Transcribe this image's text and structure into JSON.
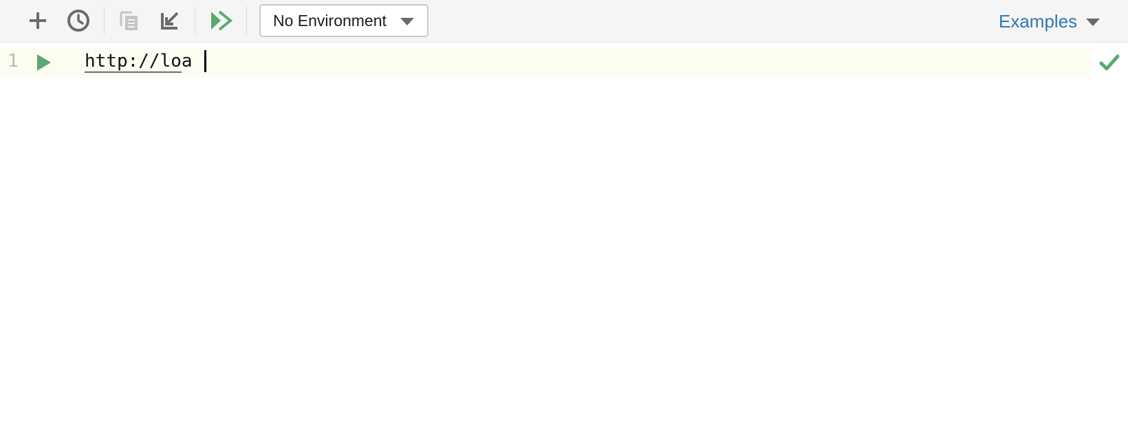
{
  "toolbar": {
    "buttons": [
      {
        "name": "add",
        "icon": "plus-icon"
      },
      {
        "name": "history",
        "icon": "clock-icon"
      },
      {
        "name": "copy",
        "icon": "copy-icon"
      },
      {
        "name": "import",
        "icon": "arrow-down-left-icon"
      },
      {
        "name": "run-all",
        "icon": "double-play-icon"
      }
    ],
    "environment": {
      "selected": "No Environment"
    },
    "examples_label": "Examples"
  },
  "editor": {
    "lines": [
      {
        "number": "1",
        "url_prefix": "http://lo",
        "rest": "a"
      }
    ],
    "status": "valid"
  },
  "colors": {
    "toolbar_bg": "#f5f5f5",
    "icon_gray": "#6b6b6b",
    "icon_disabled": "#c4c4c4",
    "run_green": "#5aa86f",
    "link_blue": "#3278b0",
    "line_highlight": "#fcfcf1"
  }
}
